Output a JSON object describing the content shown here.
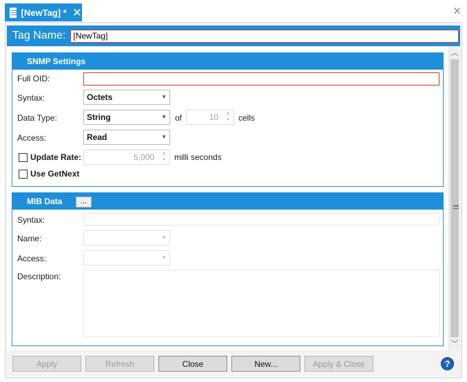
{
  "tab": {
    "title": "[NewTag] *",
    "close_glyph": "✕"
  },
  "window": {
    "close_glyph": "✕"
  },
  "tag_name": {
    "label": "Tag Name:",
    "value": "[NewTag]"
  },
  "snmp": {
    "header": "SNMP Settings",
    "full_oid_label": "Full OID:",
    "full_oid_value": "",
    "syntax_label": "Syntax:",
    "syntax_value": "Octets",
    "data_type_label": "Data Type:",
    "data_type_value": "String",
    "of_label": "of",
    "cells_count": "10",
    "cells_label": "cells",
    "access_label": "Access:",
    "access_value": "Read",
    "update_rate_label": "Update Rate:",
    "update_rate_value": "5,000",
    "update_rate_unit": "milli seconds",
    "use_getnext_label": "Use GetNext"
  },
  "mib": {
    "header": "MIB Data",
    "ellipsis": "...",
    "syntax_label": "Syntax:",
    "name_label": "Name:",
    "access_label": "Access:",
    "description_label": "Description:"
  },
  "buttons": {
    "apply": "Apply",
    "refresh": "Refresh",
    "close": "Close",
    "new": "New...",
    "apply_close": "Apply & Close",
    "help": "?"
  },
  "icons": {
    "tab_icon": "document-icon",
    "dropdown": "chevron-down-icon",
    "spinner": "spinner-icon",
    "scroll_up": "scroll-up-icon",
    "scroll_down": "scroll-down-icon",
    "help": "help-icon"
  },
  "colors": {
    "accent": "#1e8fd8",
    "error_border": "#c8361f",
    "help": "#1d63b8"
  }
}
